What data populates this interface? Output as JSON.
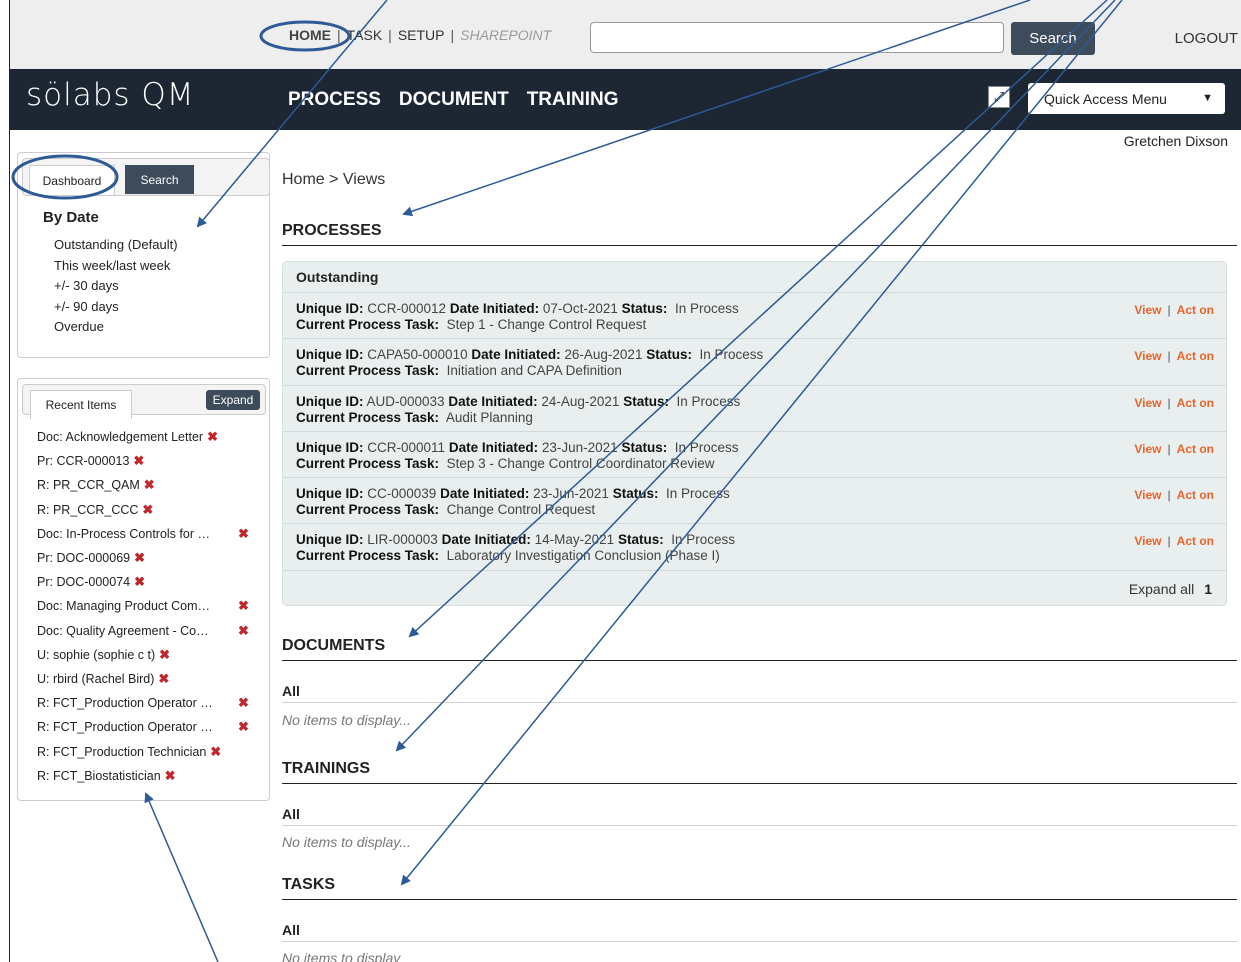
{
  "top_nav": {
    "home": "HOME",
    "task": "TASK",
    "setup": "SETUP",
    "sharepoint": "SHAREPOINT",
    "sep": "|",
    "search_button": "Search",
    "logout": "LOGOUT"
  },
  "brand": {
    "logo": "sölabs QM"
  },
  "main_nav": [
    "PROCESS",
    "DOCUMENT",
    "TRAINING"
  ],
  "quick_access": {
    "label": "Quick Access Menu",
    "caret": "▼"
  },
  "popout_icon": "⤢",
  "user_name": "Gretchen Dixson",
  "dashboard_panel": {
    "tabs": [
      "Dashboard",
      "Search"
    ],
    "heading": "By Date",
    "items": [
      "Outstanding (Default)",
      "This week/last week",
      "+/- 30 days",
      "+/- 90 days",
      "Overdue"
    ]
  },
  "recent_panel": {
    "tab": "Recent Items",
    "expand": "Expand",
    "remove_icon": "✖",
    "items": [
      "Doc: Acknowledgement Letter",
      "Pr: CCR-000013",
      "R: PR_CCR_QAM",
      "R: PR_CCR_CCC",
      "Doc: In-Process Controls for …",
      "Pr: DOC-000069",
      "Pr: DOC-000074",
      "Doc: Managing Product Com…",
      "Doc: Quality Agreement - Co…",
      "U: sophie (sophie c t)",
      "U: rbird (Rachel Bird)",
      "R: FCT_Production Operator …",
      "R: FCT_Production Operator …",
      "R: FCT_Production Technician",
      "R: FCT_Biostatistician"
    ]
  },
  "breadcrumb": "Home > Views",
  "processes": {
    "title": "PROCESSES",
    "group": "Outstanding",
    "labels": {
      "id": "Unique ID:",
      "date": "Date Initiated:",
      "status": "Status:",
      "task": "Current Process Task:"
    },
    "actions": {
      "view": "View",
      "sep": "|",
      "act": "Act on"
    },
    "rows": [
      {
        "id": "CCR-000012",
        "date": "07-Oct-2021",
        "status": "In Process",
        "task": "Step 1 - Change Control Request"
      },
      {
        "id": "CAPA50-000010",
        "date": "26-Aug-2021",
        "status": "In Process",
        "task": "Initiation and CAPA Definition"
      },
      {
        "id": "AUD-000033",
        "date": "24-Aug-2021",
        "status": "In Process",
        "task": "Audit Planning"
      },
      {
        "id": "CCR-000011",
        "date": "23-Jun-2021",
        "status": "In Process",
        "task": "Step 3 - Change Control Coordinator Review"
      },
      {
        "id": "CC-000039",
        "date": "23-Jun-2021",
        "status": "In Process",
        "task": "Change Control Request"
      },
      {
        "id": "LIR-000003",
        "date": "14-May-2021",
        "status": "In Process",
        "task": "Laboratory Investigation Conclusion (Phase I)"
      }
    ],
    "footer": {
      "expand_all": "Expand all",
      "page": "1"
    }
  },
  "documents": {
    "title": "DOCUMENTS",
    "sub": "All",
    "empty": "No items to display..."
  },
  "trainings": {
    "title": "TRAININGS",
    "sub": "All",
    "empty": "No items to display..."
  },
  "tasks": {
    "title": "TASKS",
    "sub": "All",
    "empty": "No items to display"
  },
  "colors": {
    "navbar": "#1c2733",
    "button": "#3d4b5a",
    "action": "#e8642a",
    "remove": "#c0272d",
    "annotation": "#2e5a95"
  }
}
